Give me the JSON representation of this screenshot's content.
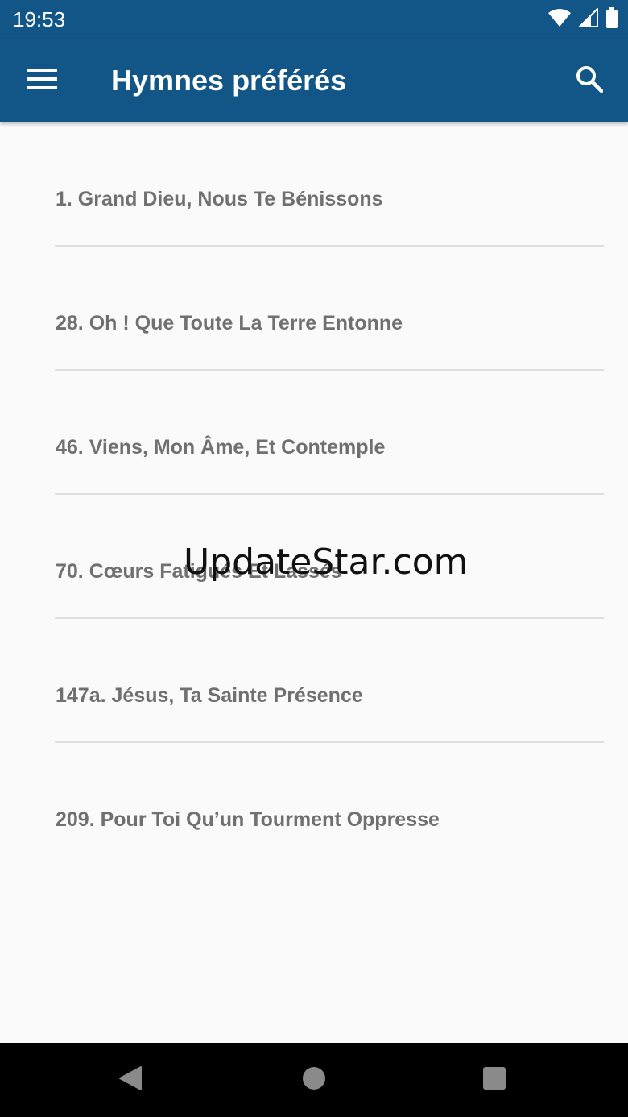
{
  "status_bar": {
    "time": "19:53",
    "icons": [
      "wifi-icon",
      "signal-icon",
      "battery-icon"
    ]
  },
  "app_bar": {
    "title": "Hymnes préférés",
    "menu_icon": "hamburger-menu-icon",
    "search_icon": "search-icon",
    "background_color": "#125687"
  },
  "hymns": [
    {
      "title": "1. Grand Dieu, Nous Te Bénissons"
    },
    {
      "title": "28. Oh ! Que Toute La Terre Entonne"
    },
    {
      "title": "46. Viens, Mon Âme, Et Contemple"
    },
    {
      "title": "70. Cœurs Fatigués Et Lassés"
    },
    {
      "title": "147a. Jésus, Ta Sainte Présence"
    },
    {
      "title": "209. Pour Toi Qu’un Tourment Oppresse"
    }
  ],
  "watermark": "UpdateStar.com",
  "nav_bar": {
    "icons": [
      "back-icon",
      "home-icon",
      "recents-icon"
    ]
  }
}
